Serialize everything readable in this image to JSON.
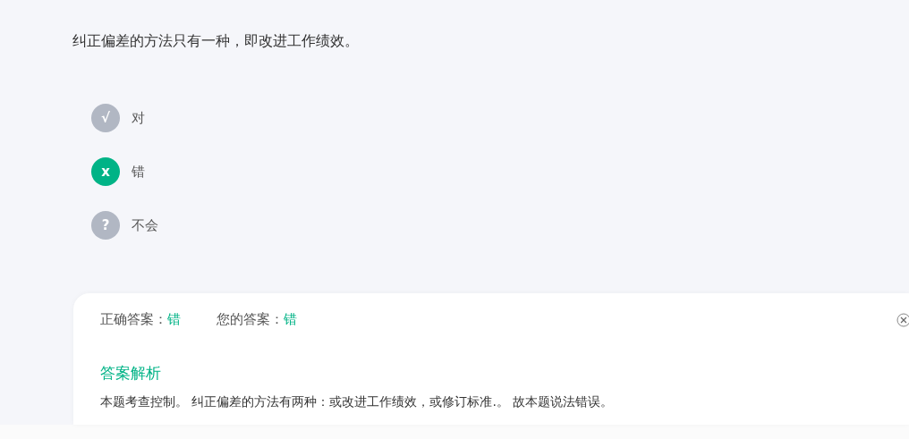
{
  "question": "纠正偏差的方法只有一种，即改进工作绩效。",
  "options": [
    {
      "mark": "√",
      "label": "对",
      "selected": false
    },
    {
      "mark": "x",
      "label": "错",
      "selected": true
    },
    {
      "mark": "?",
      "label": "不会",
      "selected": false
    }
  ],
  "answer_card": {
    "correct_label": "正确答案：",
    "correct_value": "错",
    "yours_label": "您的答案：",
    "yours_value": "错",
    "analysis_title": "答案解析",
    "analysis_text": "本题考查控制。 纠正偏差的方法有两种：或改进工作绩效，或修订标准.。 故本题说法错误。"
  }
}
